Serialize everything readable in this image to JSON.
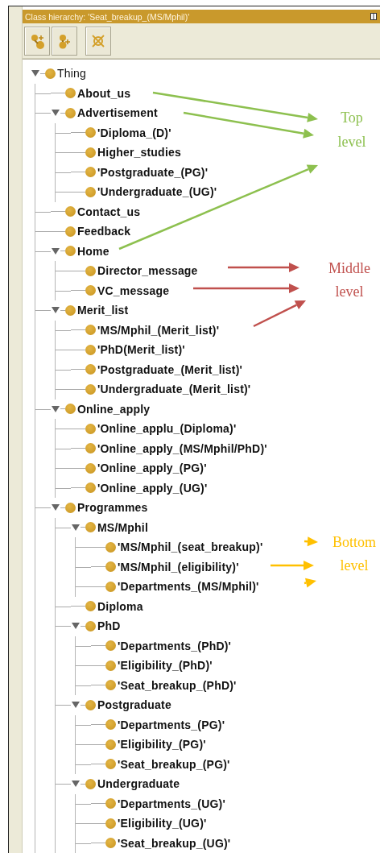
{
  "panel": {
    "title": "Class hierarchy: 'Seat_breakup_(MS/Mphil)'"
  },
  "toolbar": {
    "buttons": [
      {
        "kind": "add-subclass"
      },
      {
        "kind": "add-sibling"
      },
      {
        "kind": "delete"
      }
    ]
  },
  "tree": [
    {
      "label": "Thing",
      "expanded": true,
      "children": [
        {
          "label": "About_us"
        },
        {
          "label": "Advertisement",
          "expanded": true,
          "children": [
            {
              "label": "'Diploma_(D)'"
            },
            {
              "label": "Higher_studies"
            },
            {
              "label": "'Postgraduate_(PG)'"
            },
            {
              "label": "'Undergraduate_(UG)'"
            }
          ]
        },
        {
          "label": "Contact_us"
        },
        {
          "label": "Feedback"
        },
        {
          "label": "Home",
          "expanded": true,
          "children": [
            {
              "label": "Director_message"
            },
            {
              "label": "VC_message"
            }
          ]
        },
        {
          "label": "Merit_list",
          "expanded": true,
          "children": [
            {
              "label": "'MS/Mphil_(Merit_list)'"
            },
            {
              "label": "'PhD(Merit_list)'"
            },
            {
              "label": "'Postgraduate_(Merit_list)'"
            },
            {
              "label": "'Undergraduate_(Merit_list)'"
            }
          ]
        },
        {
          "label": "Online_apply",
          "expanded": true,
          "children": [
            {
              "label": "'Online_applu_(Diploma)'"
            },
            {
              "label": "'Online_apply_(MS/Mphil/PhD)'"
            },
            {
              "label": "'Online_apply_(PG)'"
            },
            {
              "label": "'Online_apply_(UG)'"
            }
          ]
        },
        {
          "label": "Programmes",
          "expanded": true,
          "children": [
            {
              "label": "MS/Mphil",
              "expanded": true,
              "children": [
                {
                  "label": "'MS/Mphil_(seat_breakup)'"
                },
                {
                  "label": "'MS/Mphil_(eligibility)'"
                },
                {
                  "label": "'Departments_(MS/Mphil)'"
                }
              ]
            },
            {
              "label": "Diploma"
            },
            {
              "label": "PhD",
              "expanded": true,
              "children": [
                {
                  "label": "'Departments_(PhD)'"
                },
                {
                  "label": "'Eligibility_(PhD)'"
                },
                {
                  "label": "'Seat_breakup_(PhD)'"
                }
              ]
            },
            {
              "label": "Postgraduate",
              "expanded": true,
              "children": [
                {
                  "label": "'Departments_(PG)'"
                },
                {
                  "label": "'Eligibility_(PG)'"
                },
                {
                  "label": "'Seat_breakup_(PG)'"
                }
              ]
            },
            {
              "label": "Undergraduate",
              "expanded": true,
              "children": [
                {
                  "label": "'Departments_(UG)'"
                },
                {
                  "label": "'Eligibility_(UG)'"
                },
                {
                  "label": "'Seat_breakup_(UG)'"
                }
              ]
            }
          ]
        }
      ]
    }
  ],
  "annotations": [
    {
      "lines": [
        "Top",
        "level"
      ],
      "color": "#8dc04f"
    },
    {
      "lines": [
        "Middle",
        "level"
      ],
      "color": "#c0504d"
    },
    {
      "lines": [
        "Bottom",
        "level"
      ],
      "color": "#ffc000"
    }
  ]
}
